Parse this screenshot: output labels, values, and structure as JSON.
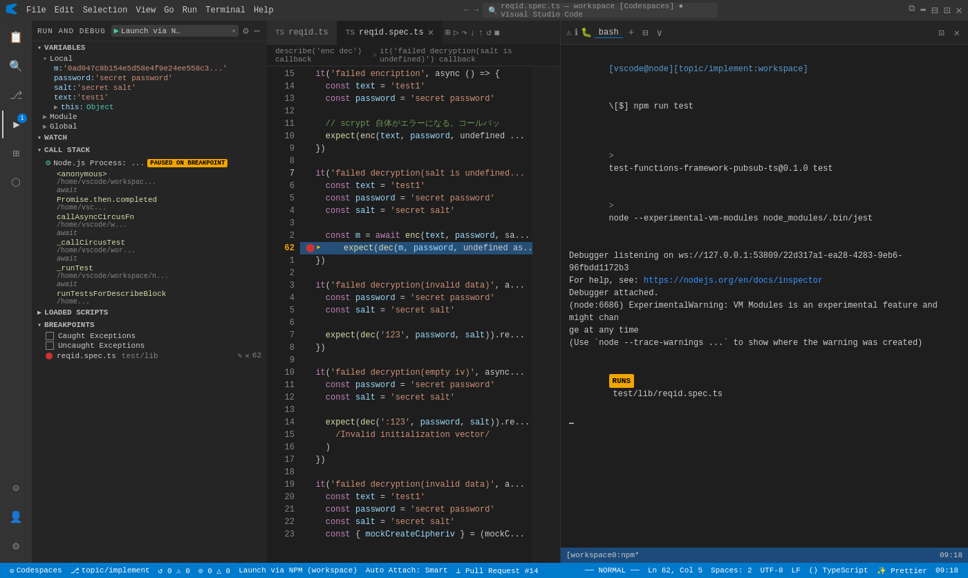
{
  "titlebar": {
    "menu": [
      "File",
      "Edit",
      "Selection",
      "View",
      "Go",
      "Run",
      "Terminal",
      "Help"
    ],
    "search_text": "reqid.spec.ts — workspace [Codespaces] ● Visual Studio Code",
    "nav_back": "←",
    "nav_forward": "→"
  },
  "activity_bar": {
    "icons": [
      {
        "name": "vscode-logo",
        "symbol": "⬛",
        "active": false
      },
      {
        "name": "explorer-icon",
        "symbol": "📄",
        "active": false
      },
      {
        "name": "search-icon",
        "symbol": "🔍",
        "active": false
      },
      {
        "name": "source-control-icon",
        "symbol": "⎇",
        "active": false
      },
      {
        "name": "debug-icon",
        "symbol": "▶",
        "active": true,
        "badge": "1"
      },
      {
        "name": "extensions-icon",
        "symbol": "⊞",
        "active": false
      },
      {
        "name": "test-icon",
        "symbol": "🧪",
        "active": false
      }
    ],
    "bottom_icons": [
      {
        "name": "remote-icon",
        "symbol": "⊙"
      },
      {
        "name": "accounts-icon",
        "symbol": "👤"
      },
      {
        "name": "settings-icon",
        "symbol": "⚙"
      }
    ]
  },
  "debug_panel": {
    "header": "RUN AND DEBUG",
    "config_name": "Launch via N…",
    "variables_section": "VARIABLES",
    "local_section": "Local",
    "variables": [
      {
        "key": "m:",
        "val": "'0ad047c8b154e5d58e4f9e24ee558c3...'"
      },
      {
        "key": "password:",
        "val": "'secret password'"
      },
      {
        "key": "salt:",
        "val": "'secret salt'"
      },
      {
        "key": "text:",
        "val": "'test1'"
      }
    ],
    "this_label": "this:",
    "this_val": "Object",
    "module_label": "Module",
    "global_label": "Global",
    "watch_section": "WATCH",
    "call_stack_section": "CALL STACK",
    "process_name": "Node.js Process: ...",
    "paused_label": "PAUSED ON BREAKPOINT",
    "frames": [
      {
        "fn": "<anonymous>",
        "path": "/home/vscode/workspac...",
        "has_await": true
      },
      {
        "fn": "Promise.then.completed",
        "path": "/home/vsc...",
        "has_await": true
      },
      {
        "fn": "callAsyncCircusFn",
        "path": "/home/vscode/w...",
        "has_await": false
      },
      {
        "fn": "_callCircusTest",
        "path": "/home/vscode/wor...",
        "has_await": true
      },
      {
        "fn": "_runTest",
        "path": "/home/vscode/workspace/n...",
        "has_await": true
      },
      {
        "fn": "runTestsForDescribeBlock",
        "path": "/home...",
        "has_await": false
      }
    ],
    "loaded_scripts": "LOADED SCRIPTS",
    "breakpoints_section": "BREAKPOINTS",
    "breakpoints": [
      {
        "label": "Caught Exceptions",
        "checked": false
      },
      {
        "label": "Uncaught Exceptions",
        "checked": false
      }
    ],
    "bp_file": "reqid.spec.ts",
    "bp_path": "test/lib",
    "bp_line": "62"
  },
  "tabs": [
    {
      "label": "reqid.ts",
      "ext": "TS",
      "active": false,
      "modified": false
    },
    {
      "label": "reqid.spec.ts",
      "ext": "TS",
      "active": true,
      "modified": false
    }
  ],
  "breadcrumb": {
    "items": [
      "describe('enc dec') callback",
      ">",
      "it('failed decryption(salt is undefined)') callback"
    ]
  },
  "editor": {
    "lines": [
      {
        "num": "15",
        "content": "  it('failed encription', async () => {",
        "highlight": false
      },
      {
        "num": "14",
        "content": "    const text = 'test1'",
        "highlight": false
      },
      {
        "num": "13",
        "content": "    const password = 'secret password'",
        "highlight": false
      },
      {
        "num": "12",
        "content": "",
        "highlight": false
      },
      {
        "num": "11",
        "content": "    // scrypt 自体がエラーになる。コールバッ",
        "highlight": false,
        "is_comment": true
      },
      {
        "num": "10",
        "content": "    expect(enc(text, password, undefined ...",
        "highlight": false
      },
      {
        "num": "9",
        "content": "  })",
        "highlight": false
      },
      {
        "num": "8",
        "content": "",
        "highlight": false
      },
      {
        "num": "7",
        "content": "  it('failed decryption(salt is undefined...",
        "highlight": false
      },
      {
        "num": "6",
        "content": "    const text = 'test1'",
        "highlight": false
      },
      {
        "num": "5",
        "content": "    const password = 'secret password'",
        "highlight": false
      },
      {
        "num": "4",
        "content": "    const salt = 'secret salt'",
        "highlight": false
      },
      {
        "num": "3",
        "content": "",
        "highlight": false
      },
      {
        "num": "2",
        "content": "    const m = await enc(text, password, sa...",
        "highlight": false
      },
      {
        "num": "bp62",
        "content": "    expect(● dec(m, password, undefined as...",
        "highlight": true,
        "breakpoint": true
      },
      {
        "num": "1",
        "content": "  })",
        "highlight": false
      },
      {
        "num": "2",
        "content": "",
        "highlight": false
      },
      {
        "num": "3",
        "content": "  it('failed decryption(invalid data)', a...",
        "highlight": false
      },
      {
        "num": "4",
        "content": "    const password = 'secret password'",
        "highlight": false
      },
      {
        "num": "5",
        "content": "    const salt = 'secret salt'",
        "highlight": false
      },
      {
        "num": "6",
        "content": "",
        "highlight": false
      },
      {
        "num": "7",
        "content": "    expect(dec('123', password, salt)).re...",
        "highlight": false
      },
      {
        "num": "8",
        "content": "  })",
        "highlight": false
      },
      {
        "num": "9",
        "content": "",
        "highlight": false
      },
      {
        "num": "10",
        "content": "  it('failed decryption(empty iv)', async...",
        "highlight": false
      },
      {
        "num": "11",
        "content": "    const password = 'secret password'",
        "highlight": false
      },
      {
        "num": "12",
        "content": "    const salt = 'secret salt'",
        "highlight": false
      },
      {
        "num": "13",
        "content": "",
        "highlight": false
      },
      {
        "num": "14",
        "content": "    expect(dec(':123', password, salt)).re...",
        "highlight": false
      },
      {
        "num": "15",
        "content": "      /Invalid initialization vector/",
        "highlight": false
      },
      {
        "num": "16",
        "content": "    )",
        "highlight": false
      },
      {
        "num": "17",
        "content": "  })",
        "highlight": false
      },
      {
        "num": "18",
        "content": "",
        "highlight": false
      },
      {
        "num": "19",
        "content": "  it('failed decryption(invalid data)', a...",
        "highlight": false
      },
      {
        "num": "20",
        "content": "    const text = 'test1'",
        "highlight": false
      },
      {
        "num": "21",
        "content": "    const password = 'secret password'",
        "highlight": false
      },
      {
        "num": "22",
        "content": "    const salt = 'secret salt'",
        "highlight": false
      },
      {
        "num": "23",
        "content": "    const { mockCreateCipheriv } = (mockC...",
        "highlight": false
      }
    ]
  },
  "terminal": {
    "title": "bash",
    "lines": [
      {
        "type": "prompt",
        "text": "[vscode@node][topic/implement:workspace]"
      },
      {
        "type": "cmd",
        "text": "\\[$] npm run test"
      },
      {
        "type": "blank"
      },
      {
        "type": "output",
        "text": "> test-functions-framework-pubsub-ts@0.1.0 test"
      },
      {
        "type": "output",
        "text": "> node --experimental-vm-modules node_modules/.bin/jest"
      },
      {
        "type": "blank"
      },
      {
        "type": "output",
        "text": "Debugger listening on ws://127.0.0.1:53809/22d317a1-ea28-4283-9eb6-96fbdd1172b3"
      },
      {
        "type": "output",
        "text": "For help, see: https://nodejs.org/en/docs/inspector"
      },
      {
        "type": "output",
        "text": "Debugger attached."
      },
      {
        "type": "output",
        "text": "(node:6686) ExperimentalWarning: VM Modules is an experimental feature and might chan"
      },
      {
        "type": "output",
        "text": "ge at any time"
      },
      {
        "type": "output",
        "text": "(Use `node --trace-warnings ...` to show where the warning was created)"
      },
      {
        "type": "blank"
      },
      {
        "type": "runs",
        "runs": "RUNS",
        "path": "test/lib/reqid.spec.ts"
      },
      {
        "type": "blank"
      }
    ]
  },
  "status_bar": {
    "left": [
      {
        "icon": "⊙",
        "text": "Codespaces"
      },
      {
        "icon": "⎇",
        "text": "topic/implement"
      },
      {
        "icon": "",
        "text": "↺ 0 ⚠ 0"
      },
      {
        "icon": "",
        "text": "⊙ 0 △ 0"
      }
    ],
    "center": [
      {
        "text": "Launch via NPM (workspace)"
      },
      {
        "text": "Auto Attach: Smart"
      },
      {
        "text": "⟂ Pull Request #14"
      }
    ],
    "right": [
      {
        "text": "── NORMAL ──"
      },
      {
        "text": "Ln 62, Col 5"
      },
      {
        "text": "Spaces: 2"
      },
      {
        "text": "UTF-8"
      },
      {
        "text": "LF"
      },
      {
        "text": "() TypeScript"
      },
      {
        "text": "✨ Prettier"
      },
      {
        "text": "09:18"
      }
    ]
  }
}
